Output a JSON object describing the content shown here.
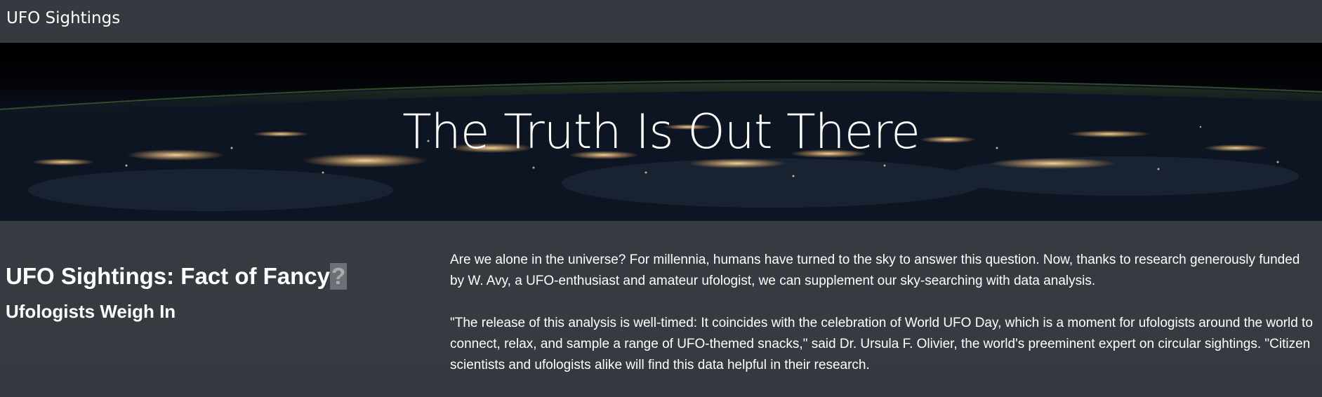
{
  "navbar": {
    "brand": "UFO Sightings"
  },
  "hero": {
    "title": "The Truth Is Out There"
  },
  "main": {
    "headline": "UFO Sightings: Fact of Fancy",
    "headline_highlight": "?",
    "subheadline": "Ufologists Weigh In",
    "paragraphs": [
      "Are we alone in the universe? For millennia, humans have turned to the sky to answer this question. Now, thanks to research generously funded by W. Avy, a UFO-enthusiast and amateur ufologist, we can supplement our sky-searching with data analysis.",
      "\"The release of this analysis is well-timed: It coincides with the celebration of World UFO Day, which is a moment for ufologists around the world to connect, relax, and sample a range of UFO-themed snacks,\" said Dr. Ursula F. Olivier, the world's preeminent expert on circular sightings. \"Citizen scientists and ufologists alike will find this data helpful in their research."
    ]
  },
  "colors": {
    "navbar_bg": "#343a40",
    "content_bg": "#363b42",
    "text": "#ffffff"
  }
}
